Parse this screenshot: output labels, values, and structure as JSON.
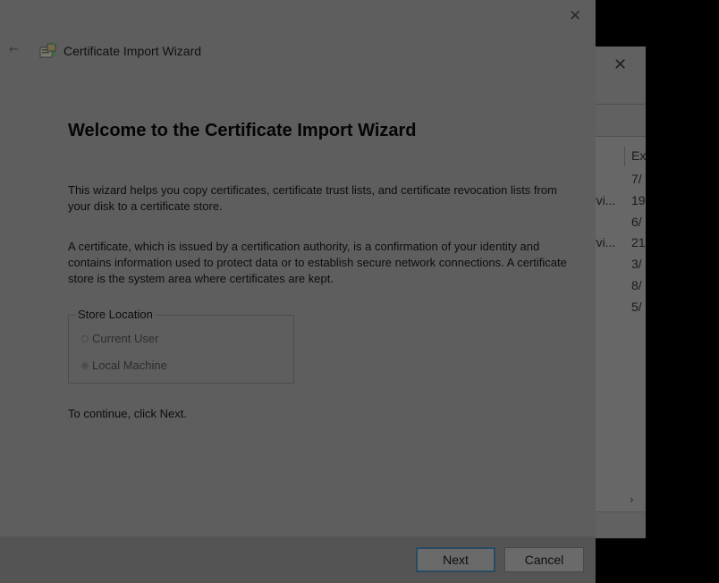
{
  "background_window": {
    "close_glyph": "✕",
    "column_header": "Ex",
    "rows": [
      {
        "col1": "",
        "col2": "7/"
      },
      {
        "col1": "rvi...",
        "col2": "19"
      },
      {
        "col1": "",
        "col2": "6/"
      },
      {
        "col1": "rvi...",
        "col2": "21"
      },
      {
        "col1": "",
        "col2": "3/"
      },
      {
        "col1": "",
        "col2": "8/"
      },
      {
        "col1": "",
        "col2": "5/"
      }
    ],
    "scroll_right_glyph": "›"
  },
  "wizard": {
    "title": "Certificate Import Wizard",
    "back_glyph": "←",
    "close_glyph": "✕",
    "heading": "Welcome to the Certificate Import Wizard",
    "paragraph1": "This wizard helps you copy certificates, certificate trust lists, and certificate revocation lists from your disk to a certificate store.",
    "paragraph2": "A certificate, which is issued by a certification authority, is a confirmation of your identity and contains information used to protect data or to establish secure network connections. A certificate store is the system area where certificates are kept.",
    "store_location": {
      "legend": "Store Location",
      "options": [
        {
          "label": "Current User",
          "selected": false
        },
        {
          "label": "Local Machine",
          "selected": true
        }
      ]
    },
    "continue_text": "To continue, click Next.",
    "buttons": {
      "next": "Next",
      "cancel": "Cancel"
    },
    "icon": "certificate-icon"
  },
  "colors": {
    "overlay_dark": "#000000",
    "wizard_bg": "#5e5e5e",
    "default_button_border": "#2a4a63"
  }
}
